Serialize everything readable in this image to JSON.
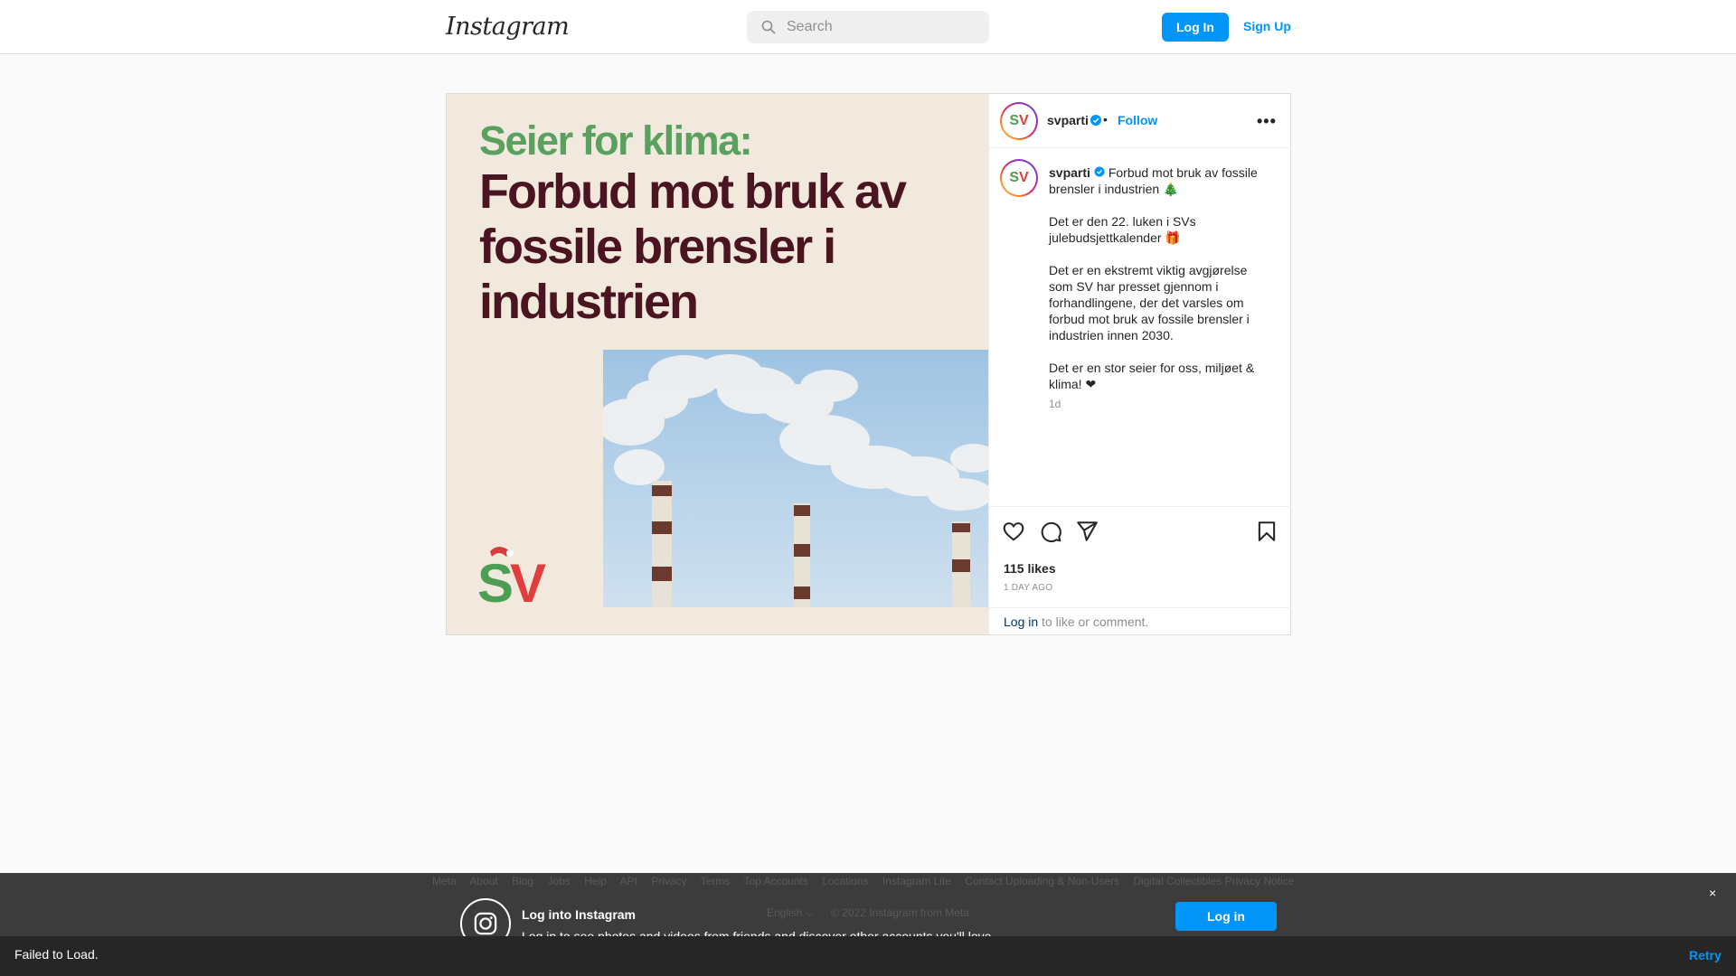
{
  "header": {
    "logo": "Instagram",
    "search_placeholder": "Search",
    "login_label": "Log In",
    "signup_label": "Sign Up"
  },
  "post": {
    "image": {
      "kicker": "Seier for klima:",
      "headline": "Forbud mot bruk av fossile brensler i industrien"
    },
    "author": "svparti",
    "avatar_text_s": "S",
    "avatar_text_v": "V",
    "follow_label": "Follow",
    "dot": "•",
    "more": "•••",
    "caption": {
      "user": "svparti",
      "p1": "Forbud mot bruk av fossile brensler i industrien 🎄",
      "p2": "Det er den 22. luken i SVs julebudsjettkalender 🎁",
      "p3": "Det er en ekstremt viktig avgjørelse som SV har presset gjennom i forhandlingene, der det varsles om forbud mot bruk av fossile brensler i industrien innen 2030.",
      "p4": "Det er en stor seier for oss, miljøet & klima! ❤"
    },
    "age_short": "1d",
    "likes": "115 likes",
    "age_long": "1 DAY AGO",
    "login_link": "Log in",
    "login_rest": " to like or comment."
  },
  "footer": {
    "links": [
      "Meta",
      "About",
      "Blog",
      "Jobs",
      "Help",
      "API",
      "Privacy",
      "Terms",
      "Top Accounts",
      "Locations",
      "Instagram Lite",
      "Contact Uploading & Non-Users",
      "Digital Collectibles Privacy Notice"
    ],
    "language": "English ⌵",
    "copyright": "© 2022 Instagram from Meta",
    "login_title": "Log into Instagram",
    "login_sub": "Log in to see photos and videos from friends and discover other accounts you'll love.",
    "login_button": "Log in",
    "close": "×"
  },
  "status": {
    "message": "Failed to Load.",
    "retry": "Retry"
  },
  "colors": {
    "accent": "#0095f6",
    "sv_green": "#5aa05f",
    "sv_red": "#e23d3d",
    "headline": "#4a1420"
  }
}
